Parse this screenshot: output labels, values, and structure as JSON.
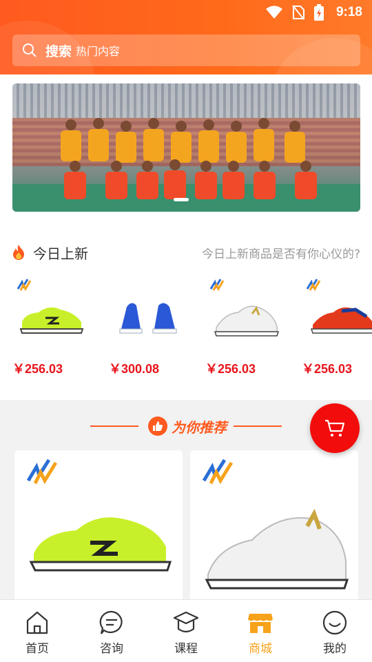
{
  "status_bar": {
    "time": "9:18"
  },
  "search": {
    "label": "搜索",
    "placeholder": "热门内容"
  },
  "new_today": {
    "title": "今日上新",
    "subtitle": "今日上新商品是否有你心仪的?",
    "products": [
      {
        "price": "￥256.03",
        "shoe_color": "#c8f02a"
      },
      {
        "price": "￥300.08",
        "shoe_color": "#2b58d6"
      },
      {
        "price": "￥256.03",
        "shoe_color": "#f1f1f1"
      },
      {
        "price": "￥256.03",
        "shoe_color": "#e43a1c"
      }
    ]
  },
  "recommend": {
    "title": "为你推荐"
  },
  "tabs": [
    {
      "label": "首页",
      "icon": "home-icon",
      "active": false
    },
    {
      "label": "咨询",
      "icon": "chat-icon",
      "active": false
    },
    {
      "label": "课程",
      "icon": "graduation-cap-icon",
      "active": false
    },
    {
      "label": "商城",
      "icon": "store-icon",
      "active": true
    },
    {
      "label": "我的",
      "icon": "profile-icon",
      "active": false
    }
  ],
  "colors": {
    "primary": "#ff5a1f",
    "price": "#e8141b",
    "active_tab": "#f7a21b",
    "cart": "#f30c0c"
  }
}
